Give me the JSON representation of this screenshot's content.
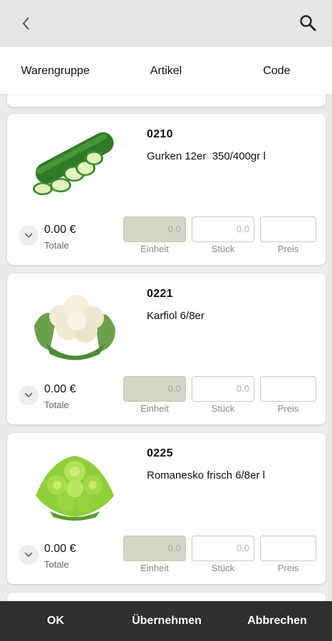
{
  "header": {
    "back_icon": "chevron-left-icon",
    "search_icon": "search-icon"
  },
  "tabs": [
    {
      "label": "Warengruppe"
    },
    {
      "label": "Artikel"
    },
    {
      "label": "Code"
    }
  ],
  "products": [
    {
      "code": "0210",
      "name": "Gurken 12er  350/400gr l",
      "image": "cucumber-image",
      "total": "0.00 €",
      "total_label": "Totale",
      "unit_value": "0.0",
      "qty_placeholder": "0.0",
      "price_value": "",
      "unit_label": "Einheit",
      "qty_label": "Stück",
      "price_label": "Preis"
    },
    {
      "code": "0221",
      "name": "Karfiol 6/8er",
      "image": "cauliflower-image",
      "total": "0.00 €",
      "total_label": "Totale",
      "unit_value": "0.0",
      "qty_placeholder": "0.0",
      "price_value": "",
      "unit_label": "Einheit",
      "qty_label": "Stück",
      "price_label": "Preis"
    },
    {
      "code": "0225",
      "name": "Romanesko frisch 6/8er l",
      "image": "romanesco-image",
      "total": "0.00 €",
      "total_label": "Totale",
      "unit_value": "0.0",
      "qty_placeholder": "0.0",
      "price_value": "",
      "unit_label": "Einheit",
      "qty_label": "Stück",
      "price_label": "Preis"
    }
  ],
  "footer": {
    "ok_label": "OK",
    "apply_label": "Übernehmen",
    "cancel_label": "Abbrechen"
  },
  "colors": {
    "unit_field_bg": "#d4d7c8",
    "footer_bg": "#2f2f2f",
    "topbar_bg": "#e6e6e6"
  }
}
